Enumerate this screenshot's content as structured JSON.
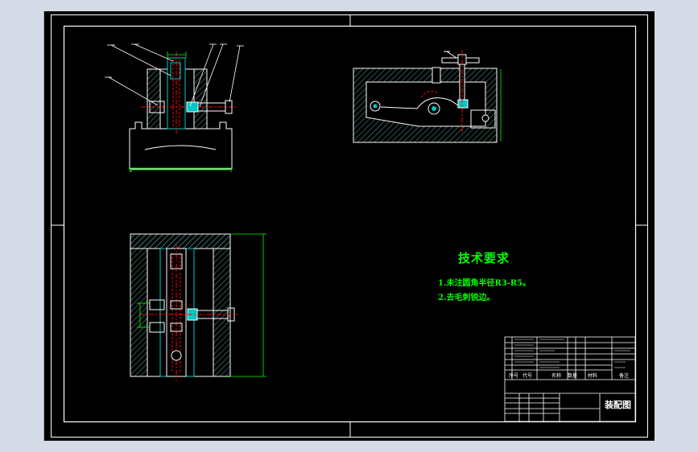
{
  "technical_requirements": {
    "title": "技术要求",
    "items": [
      "1.未注圆角半径R3-R5。",
      "2.去毛刺锐边。"
    ]
  },
  "title_block": {
    "drawing_name": "装配图",
    "header_labels": [
      "序号",
      "代号",
      "名称",
      "数量",
      "材料",
      "备注"
    ]
  },
  "colors": {
    "background": "#000000",
    "outline": "#ffffff",
    "dimension": "#00ff00",
    "centerline": "#ff0000",
    "hatch": "#4a8c86",
    "part": "#00c8c8"
  }
}
